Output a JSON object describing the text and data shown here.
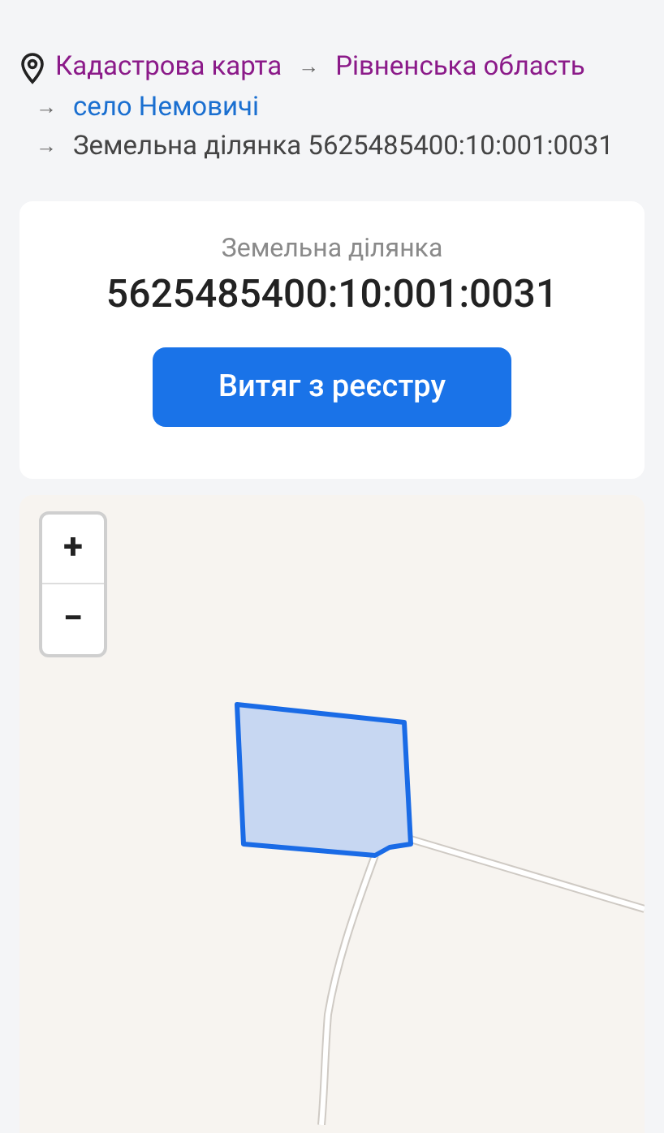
{
  "breadcrumbs": [
    {
      "label": "Кадастрова карта",
      "kind": "visited"
    },
    {
      "arrow": "→",
      "label": "Рівненська область",
      "kind": "visited"
    },
    {
      "arrow": "→",
      "label": "село Немовичі",
      "kind": "link"
    },
    {
      "arrow": "→",
      "label": "Земельна ділянка 5625485400:10:001:0031",
      "kind": "current"
    }
  ],
  "parcel_card": {
    "caption": "Земельна ділянка",
    "number": "5625485400:10:001:0031",
    "button": "Витяг з реєстру"
  },
  "map": {
    "zoom_in": "+",
    "zoom_out": "−"
  }
}
